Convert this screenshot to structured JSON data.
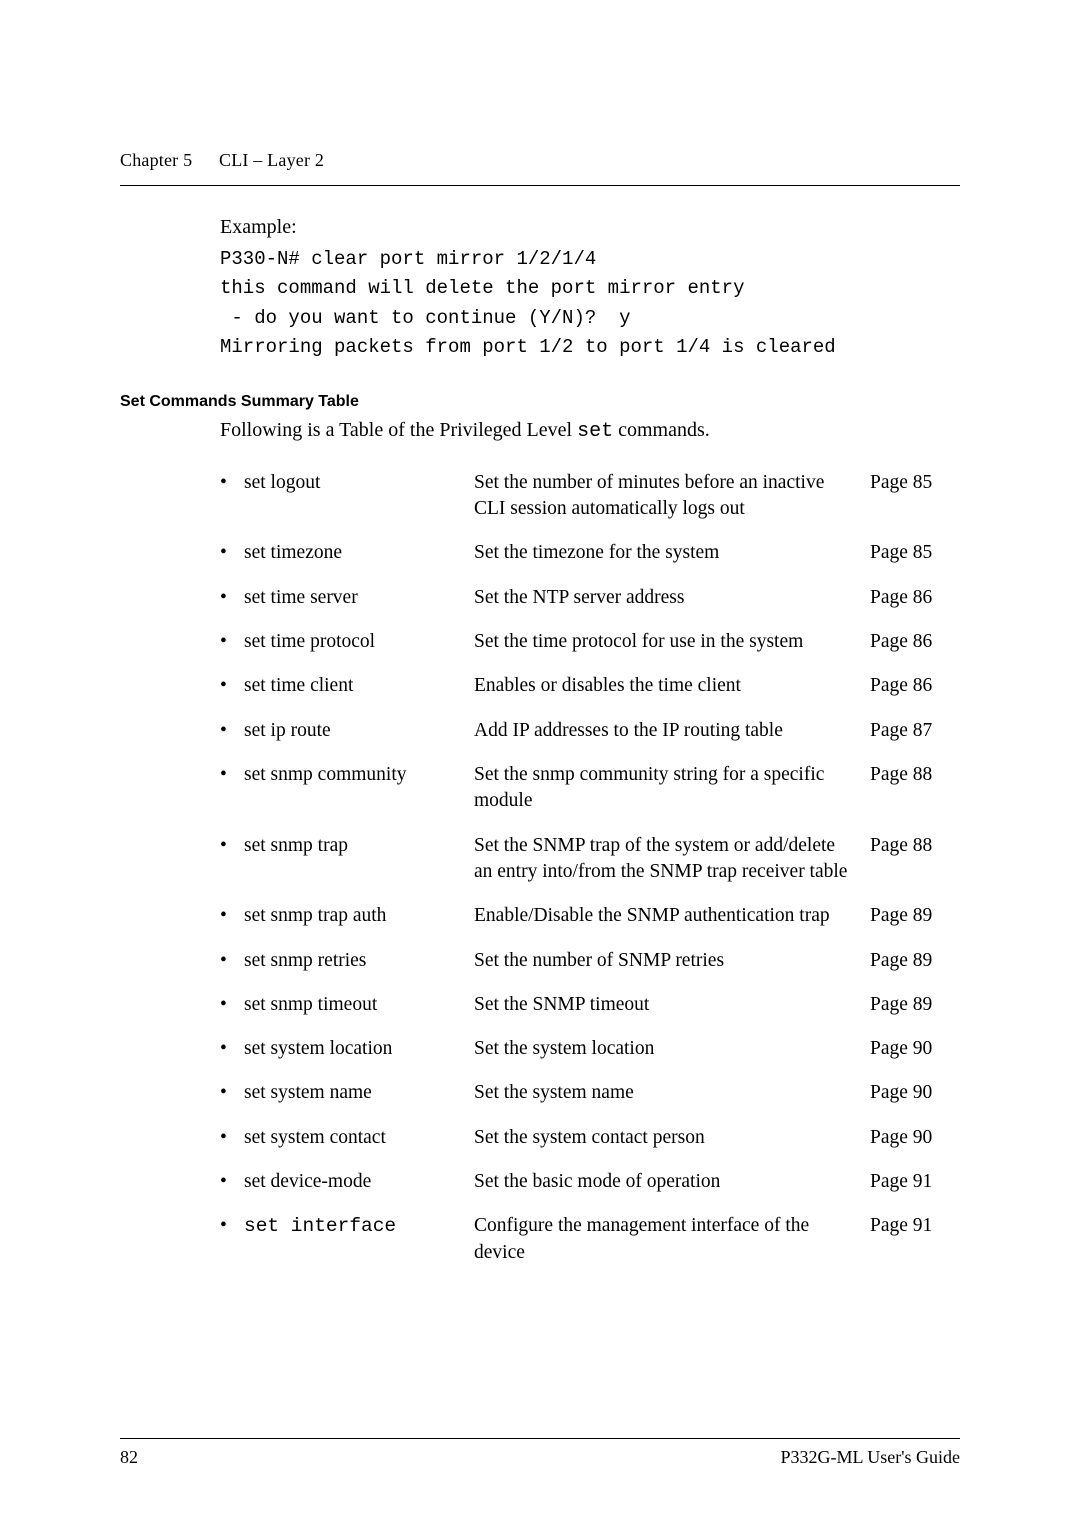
{
  "header": {
    "chapter": "Chapter 5",
    "title": "CLI – Layer 2"
  },
  "example": {
    "label": "Example:",
    "l1": "P330-N# clear port mirror 1/2/1/4",
    "l2": "this command will delete the port mirror entry",
    "l3": " - do you want to continue (Y/N)?  y",
    "l4": "Mirroring packets from port 1/2 to port 1/4 is cleared"
  },
  "set_table_heading": "Set Commands Summary Table",
  "intro_pre": "Following is a Table of the Privileged Level ",
  "intro_mono": "set",
  "intro_post": " commands.",
  "rows": [
    {
      "name": "set logout",
      "desc": "Set the number of minutes before an inactive CLI session automatically logs out",
      "page": "Page 85",
      "mono": false
    },
    {
      "name": "set timezone",
      "desc": "Set the timezone for the system",
      "page": "Page 85",
      "mono": false
    },
    {
      "name": "set time server",
      "desc": "Set the NTP server address",
      "page": "Page 86",
      "mono": false
    },
    {
      "name": "set time protocol",
      "desc": "Set the time protocol for use in the system",
      "page": "Page 86",
      "mono": false
    },
    {
      "name": "set time client",
      "desc": "Enables or disables the time client",
      "page": "Page 86",
      "mono": false
    },
    {
      "name": "set ip route",
      "desc": "Add IP addresses to the IP routing table",
      "page": "Page 87",
      "mono": false
    },
    {
      "name": "set snmp community",
      "desc": "Set the snmp community string for a specific module",
      "page": "Page 88",
      "mono": false
    },
    {
      "name": "set snmp trap",
      "desc": "Set the SNMP trap of the system or add/delete an entry into/from the SNMP trap receiver table",
      "page": "Page 88",
      "mono": false
    },
    {
      "name": "set snmp trap auth",
      "desc": "Enable/Disable the SNMP authentication trap",
      "page": "Page 89",
      "mono": false
    },
    {
      "name": "set snmp retries",
      "desc": "Set the number of SNMP retries",
      "page": "Page 89",
      "mono": false
    },
    {
      "name": "set snmp timeout",
      "desc": "Set the SNMP timeout",
      "page": "Page 89",
      "mono": false
    },
    {
      "name": "set system location",
      "desc": "Set the system location",
      "page": "Page 90",
      "mono": false
    },
    {
      "name": "set system name",
      "desc": "Set the system name",
      "page": "Page 90",
      "mono": false
    },
    {
      "name": "set system contact",
      "desc": "Set the system contact person",
      "page": "Page 90",
      "mono": false
    },
    {
      "name": "set device-mode",
      "desc": "Set the basic mode of operation",
      "page": "Page 91",
      "mono": false
    },
    {
      "name": "set interface",
      "desc": "Configure the management interface of the device",
      "page": "Page 91",
      "mono": true
    }
  ],
  "footer": {
    "pagenum": "82",
    "guide": "P332G-ML User's Guide"
  }
}
